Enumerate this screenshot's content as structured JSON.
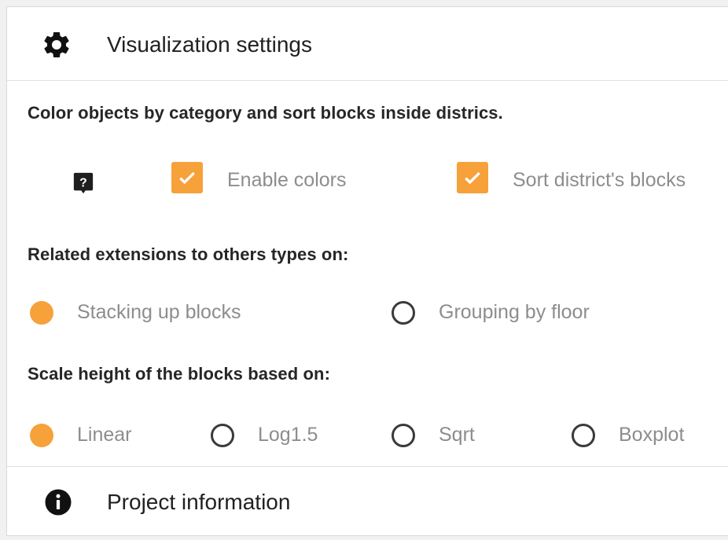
{
  "header": {
    "title": "Visualization settings",
    "icon": "gear-icon"
  },
  "colors": {
    "accent": "#f6a13a",
    "text_dark": "#262626",
    "text_muted": "#8d8d8d"
  },
  "color_section": {
    "description": "Color objects by category and sort blocks inside districs.",
    "help_icon": "help-icon",
    "enable_colors": {
      "label": "Enable colors",
      "checked": true
    },
    "sort_blocks": {
      "label": "Sort district's blocks",
      "checked": true
    }
  },
  "extensions_section": {
    "title": "Related extensions to others types on:",
    "options": [
      {
        "label": "Stacking up blocks",
        "selected": true
      },
      {
        "label": "Grouping by floor",
        "selected": false
      }
    ]
  },
  "scale_section": {
    "title": "Scale height of the blocks based on:",
    "options": [
      {
        "label": "Linear",
        "selected": true
      },
      {
        "label": "Log1.5",
        "selected": false
      },
      {
        "label": "Sqrt",
        "selected": false
      },
      {
        "label": "Boxplot",
        "selected": false
      }
    ]
  },
  "footer": {
    "title": "Project information",
    "icon": "info-icon"
  }
}
